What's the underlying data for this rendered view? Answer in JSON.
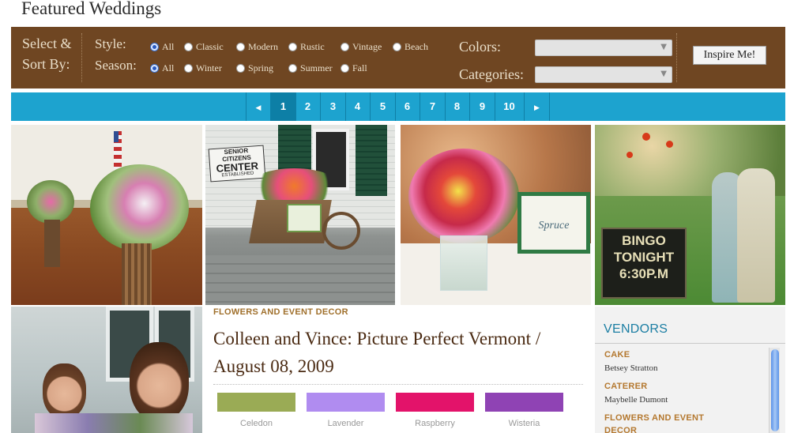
{
  "page": {
    "title": "Featured Weddings"
  },
  "filter": {
    "sort_label_line1": "Select &",
    "sort_label_line2": "Sort By:",
    "style_label": "Style:",
    "season_label": "Season:",
    "style_options": [
      "All",
      "Classic",
      "Modern",
      "Rustic",
      "Vintage",
      "Beach"
    ],
    "style_selected": "All",
    "season_options": [
      "All",
      "Winter",
      "Spring",
      "Summer",
      "Fall"
    ],
    "season_selected": "All",
    "colors_label": "Colors:",
    "categories_label": "Categories:",
    "colors_value": "",
    "categories_value": "",
    "inspire_button": "Inspire Me!"
  },
  "pagination": {
    "prev_icon": "triangle-left-icon",
    "next_icon": "triangle-right-icon",
    "pages": [
      "1",
      "2",
      "3",
      "4",
      "5",
      "6",
      "7",
      "8",
      "9",
      "10"
    ],
    "current": "1"
  },
  "photos": {
    "items": [
      {
        "icon": "photo-church-flowers"
      },
      {
        "icon": "photo-wheelbarrow-flowers",
        "sign_lines": [
          "SENIOR CITIZENS",
          "CENTER",
          "ESTABLISHED"
        ]
      },
      {
        "icon": "photo-table-centerpiece",
        "card_text": "Spruce"
      },
      {
        "icon": "photo-couple-bingo-sign",
        "sign_lines": [
          "BINGO",
          "TONIGHT",
          "6:30P.M"
        ]
      },
      {
        "icon": "photo-bridesmaids"
      }
    ]
  },
  "article": {
    "category": "FLOWERS AND EVENT DECOR",
    "headline_line1": "Colleen and Vince: Picture Perfect Vermont /",
    "headline_line2": "August 08, 2009",
    "swatches": [
      {
        "name": "Celedon",
        "color": "#9aab55"
      },
      {
        "name": "Lavender",
        "color": "#b08cf0"
      },
      {
        "name": "Raspberry",
        "color": "#e3136a"
      },
      {
        "name": "Wisteria",
        "color": "#8f43b4"
      }
    ]
  },
  "vendors": {
    "title": "VENDORS",
    "items": [
      {
        "category": "CAKE",
        "name": "Betsey Stratton"
      },
      {
        "category": "CATERER",
        "name": "Maybelle Dumont"
      },
      {
        "category": "FLOWERS AND EVENT",
        "name": ""
      },
      {
        "category": "DECOR",
        "name": ""
      }
    ]
  },
  "colors": {
    "filter_bar": "#6f4622",
    "pager": "#1da3cf",
    "accent_blue": "#1b7ea3",
    "accent_gold": "#b4782f"
  }
}
